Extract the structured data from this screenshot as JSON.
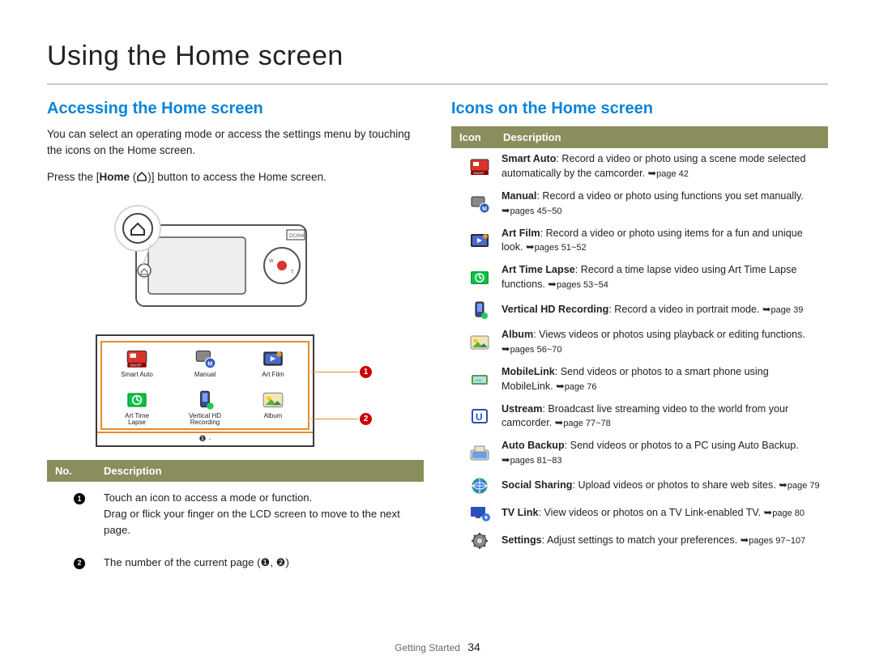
{
  "page": {
    "title": "Using the Home screen",
    "left": {
      "heading": "Accessing the Home screen",
      "intro": "You can select an operating mode or access the settings menu by touching the icons on the Home screen.",
      "press_pre": "Press the [",
      "press_bold": "Home",
      "press_post": " ( )] button to access the Home screen.",
      "home_items": [
        {
          "label": "Smart Auto"
        },
        {
          "label": "Manual"
        },
        {
          "label": "Art Film"
        },
        {
          "label": "Art Time\nLapse"
        },
        {
          "label": "Vertical HD\nRecording"
        },
        {
          "label": "Album"
        }
      ],
      "legend_headers": {
        "no": "No.",
        "desc": "Description"
      },
      "legend_rows": [
        {
          "num": "1",
          "text": "Touch an icon to access a mode or function.\nDrag or flick your finger on the LCD screen to move to the next page."
        },
        {
          "num": "2",
          "text": "The number of the current page (❶, ❷)"
        }
      ]
    },
    "right": {
      "heading": "Icons on the Home screen",
      "headers": {
        "icon": "Icon",
        "desc": "Description"
      },
      "rows": [
        {
          "id": "smart-auto",
          "title": "Smart Auto",
          "text": ": Record a video or photo using a scene mode selected automatically by the camcorder. ",
          "pref": "page 42"
        },
        {
          "id": "manual",
          "title": "Manual",
          "text": ": Record a video or photo using functions you set manually. ",
          "pref": "pages 45~50"
        },
        {
          "id": "art-film",
          "title": "Art Film",
          "text": ": Record a video or photo using items for a fun and unique look. ",
          "pref": "pages 51~52"
        },
        {
          "id": "art-time-lapse",
          "title": "Art Time Lapse",
          "text": ": Record a time lapse video using Art Time Lapse functions. ",
          "pref": "pages 53~54"
        },
        {
          "id": "vertical-hd",
          "title": "Vertical HD Recording",
          "text": ": Record a video in portrait mode. ",
          "pref": "page 39"
        },
        {
          "id": "album",
          "title": "Album",
          "text": ": Views videos or photos using playback or editing functions. ",
          "pref": "pages 56~70"
        },
        {
          "id": "mobilelink",
          "title": "MobileLink",
          "text": ": Send videos or photos to a smart phone using MobileLink. ",
          "pref": "page 76"
        },
        {
          "id": "ustream",
          "title": "Ustream",
          "text": ": Broadcast live streaming video to the world from your camcorder. ",
          "pref": "page 77~78"
        },
        {
          "id": "auto-backup",
          "title": "Auto Backup",
          "text": ": Send videos or photos to a PC using Auto Backup. ",
          "pref": "pages 81~83"
        },
        {
          "id": "social-sharing",
          "title": "Social Sharing",
          "text": ": Upload videos or photos to share web sites. ",
          "pref": "page 79"
        },
        {
          "id": "tv-link",
          "title": "TV Link",
          "text": ": View videos or photos on a TV Link-enabled TV. ",
          "pref": "page 80"
        },
        {
          "id": "settings",
          "title": "Settings",
          "text": ": Adjust settings to match your preferences. ",
          "pref": "pages 97~107"
        }
      ]
    },
    "footer": {
      "section": "Getting Started",
      "page": "34"
    }
  }
}
